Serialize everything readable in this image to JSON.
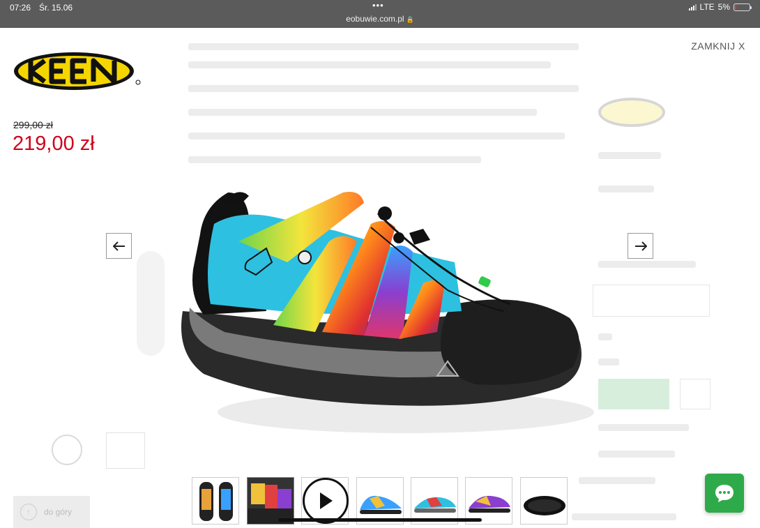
{
  "status_bar": {
    "time": "07:26",
    "date": "Śr. 15.06",
    "url": "eobuwie.com.pl",
    "network": "LTE",
    "battery": "5%"
  },
  "brand": {
    "logo_text": "KEEN",
    "logo_color": "#f4d500"
  },
  "gallery": {
    "close_label": "ZAMKNIJ X",
    "old_price": "299,00 zł",
    "new_price": "219,00 zł",
    "price_color": "#d0021b",
    "prev_icon": "arrow-left-icon",
    "next_icon": "arrow-right-icon",
    "thumbnails_count": 7,
    "active_thumbnail": 2
  },
  "background_page": {
    "back_to_top_label": "do góry"
  },
  "chat": {
    "icon": "chat-bubble-icon",
    "color": "#2eaa4b"
  }
}
